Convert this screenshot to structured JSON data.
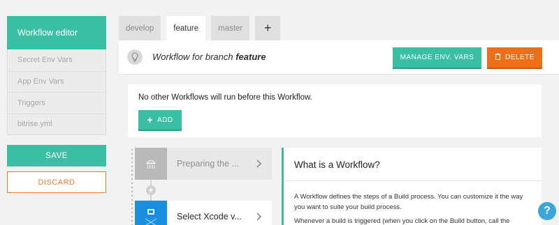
{
  "sidebar": {
    "active": "Workflow editor",
    "items": [
      {
        "label": "Secret Env Vars"
      },
      {
        "label": "App Env Vars"
      },
      {
        "label": "Triggers"
      },
      {
        "label": "bitrise.yml"
      }
    ],
    "save_label": "SAVE",
    "discard_label": "DISCARD"
  },
  "tabs": [
    {
      "label": "develop",
      "active": false
    },
    {
      "label": "feature",
      "active": true
    },
    {
      "label": "master",
      "active": false
    }
  ],
  "tab_add_label": "+",
  "header": {
    "title_prefix": "Workflow for branch",
    "branch": "feature",
    "manage_label": "MANAGE ENV. VARS",
    "delete_label": "DELETE",
    "icon": "lightbulb-icon"
  },
  "before_card": {
    "text": "No other Workflows will run before this Workflow.",
    "add_label": "ADD"
  },
  "steps": [
    {
      "label": "Preparing the ...",
      "icon": "shower-icon"
    },
    {
      "label": "Select Xcode v...",
      "icon": "xcode-icon"
    }
  ],
  "info_panel": {
    "title": "What is a Workflow?",
    "p1": "A Workflow defines the steps of a Build process. You can customize it the way you want to suite your build process.",
    "p2": "Whenever a build is triggered (when you click on the Build button, call the"
  },
  "help_label": "?",
  "colors": {
    "accent": "#3bbfa4",
    "danger": "#ef6f19",
    "discard": "#ea7a2a",
    "step_blue": "#1a8fe0"
  }
}
